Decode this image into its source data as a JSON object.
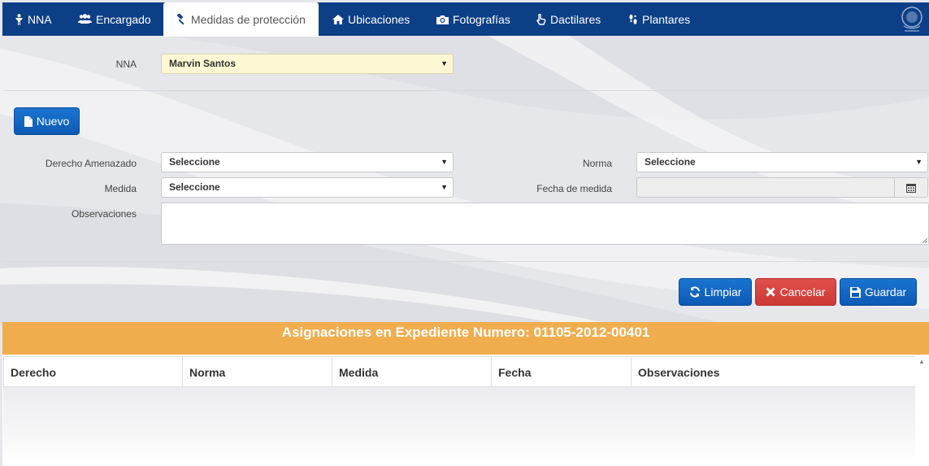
{
  "nav": {
    "tabs": [
      {
        "label": "NNA",
        "icon": "person-icon"
      },
      {
        "label": "Encargado",
        "icon": "users-icon"
      },
      {
        "label": "Medidas de protección",
        "icon": "gavel-icon",
        "active": true
      },
      {
        "label": "Ubicaciones",
        "icon": "home-icon"
      },
      {
        "label": "Fotografías",
        "icon": "camera-icon"
      },
      {
        "label": "Dactilares",
        "icon": "hand-pointer-icon"
      },
      {
        "label": "Plantares",
        "icon": "footprint-icon"
      }
    ]
  },
  "form": {
    "nna_label": "NNA",
    "nna_value": "Marvin Santos",
    "nuevo_label": "Nuevo",
    "derecho_label": "Derecho Amenazado",
    "derecho_value": "Seleccione",
    "norma_label": "Norma",
    "norma_value": "Seleccione",
    "medida_label": "Medida",
    "medida_value": "Seleccione",
    "fecha_label": "Fecha de medida",
    "fecha_value": "",
    "observaciones_label": "Observaciones",
    "observaciones_value": ""
  },
  "actions": {
    "limpiar": "Limpiar",
    "cancelar": "Cancelar",
    "guardar": "Guardar"
  },
  "banner": {
    "title": "Asignaciones en Expediente Numero: 01105-2012-00401"
  },
  "table": {
    "columns": [
      "Derecho",
      "Norma",
      "Medida",
      "Fecha",
      "Observaciones"
    ],
    "rows": []
  },
  "colors": {
    "nav_bg": "#0d3f86",
    "primary": "#0d5ab5",
    "danger": "#cc3a36",
    "banner": "#f0ad4e",
    "highlight_select": "#fdf7d3"
  }
}
